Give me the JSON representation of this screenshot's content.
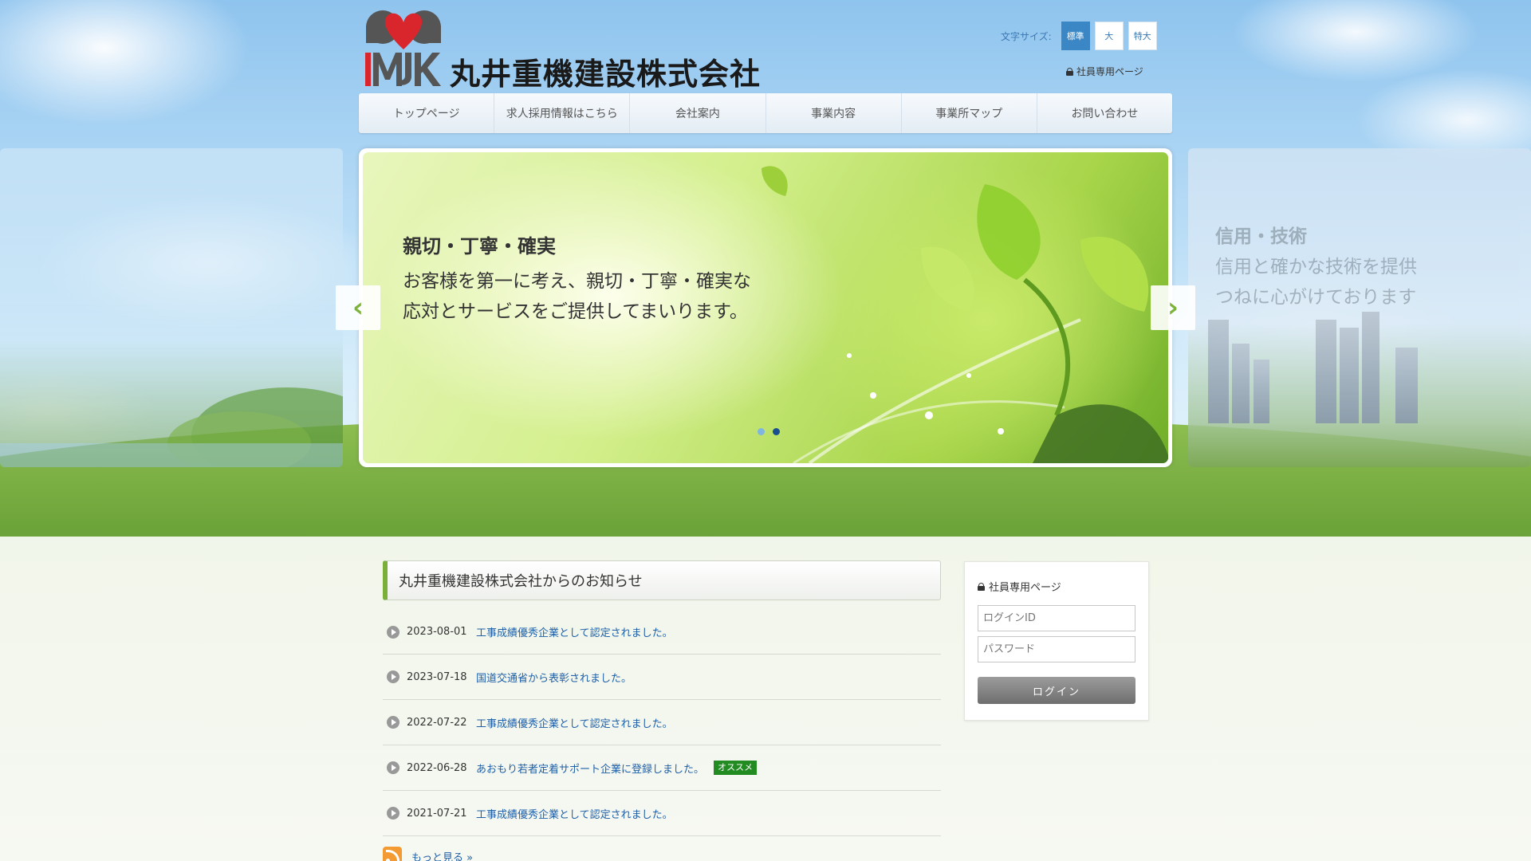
{
  "company": {
    "name": "丸井重機建設株式会社",
    "logo_letters": "MJK"
  },
  "font_size": {
    "label": "文字サイズ:",
    "options": [
      "標準",
      "大",
      "特大"
    ],
    "selected": "標準"
  },
  "staff_page_link": "社員専用ページ",
  "nav": [
    "トップページ",
    "求人採用情報はこちら",
    "会社案内",
    "事業内容",
    "事業所マップ",
    "お問い合わせ"
  ],
  "slider": {
    "current": {
      "title": "親切・丁寧・確実",
      "lines": [
        "お客様を第一に考え、親切・丁寧・確実な",
        "応対とサービスをご提供してまいります。"
      ]
    },
    "next": {
      "title": "信用・技術",
      "lines": [
        "信用と確かな技術を提供",
        "つねに心がけております"
      ]
    },
    "dots": 2,
    "active_dot": 2
  },
  "news": {
    "heading": "丸井重機建設株式会社からのお知らせ",
    "items": [
      {
        "date": "2023-08-01",
        "title": "工事成績優秀企業として認定されました。",
        "badge": ""
      },
      {
        "date": "2023-07-18",
        "title": "国道交通省から表彰されました。",
        "badge": ""
      },
      {
        "date": "2022-07-22",
        "title": "工事成績優秀企業として認定されました。",
        "badge": ""
      },
      {
        "date": "2022-06-28",
        "title": "あおもり若者定着サポート企業に登録しました。",
        "badge": "オススメ"
      },
      {
        "date": "2021-07-21",
        "title": "工事成績優秀企業として認定されました。",
        "badge": ""
      }
    ],
    "more_label": "もっと見る »"
  },
  "login": {
    "title": "社員専用ページ",
    "id_placeholder": "ログインID",
    "password_placeholder": "パスワード",
    "button_label": "ログイン"
  },
  "colors": {
    "accent_green": "#7ab03a",
    "link_blue": "#2060a8",
    "badge_green": "#228b22",
    "fontsize_active": "#3b86c4"
  }
}
